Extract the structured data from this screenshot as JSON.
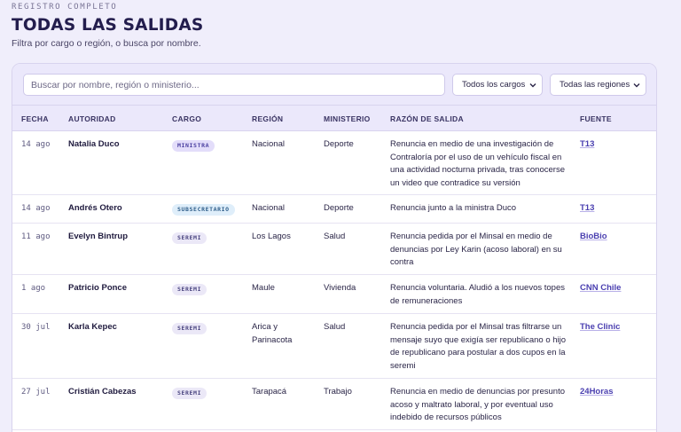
{
  "header": {
    "eyebrow": "REGISTRO COMPLETO",
    "title": "TODAS LAS SALIDAS",
    "subtitle": "Filtra por cargo o región, o busca por nombre."
  },
  "filters": {
    "search_placeholder": "Buscar por nombre, región o ministerio...",
    "cargo_value": "Todos los cargos",
    "region_value": "Todas las regiones"
  },
  "table": {
    "columns": {
      "fecha": "FECHA",
      "autoridad": "AUTORIDAD",
      "cargo": "CARGO",
      "region": "REGIÓN",
      "ministerio": "MINISTERIO",
      "razon": "RAZÓN DE SALIDA",
      "fuente": "FUENTE"
    },
    "rows": [
      {
        "fecha": "14 ago",
        "autoridad": "Natalia Duco",
        "cargo": "MINISTRA",
        "region": "Nacional",
        "ministerio": "Deporte",
        "razon": "Renuncia en medio de una investigación de Contraloría por el uso de un vehículo fiscal en una actividad nocturna privada, tras conocerse un video que contradice su versión",
        "fuente": "T13"
      },
      {
        "fecha": "14 ago",
        "autoridad": "Andrés Otero",
        "cargo": "SUBSECRETARIO",
        "region": "Nacional",
        "ministerio": "Deporte",
        "razon": "Renuncia junto a la ministra Duco",
        "fuente": "T13"
      },
      {
        "fecha": "11 ago",
        "autoridad": "Evelyn Bintrup",
        "cargo": "SEREMI",
        "region": "Los Lagos",
        "ministerio": "Salud",
        "razon": "Renuncia pedida por el Minsal en medio de denuncias por Ley Karin (acoso laboral) en su contra",
        "fuente": "BioBio"
      },
      {
        "fecha": "1 ago",
        "autoridad": "Patricio Ponce",
        "cargo": "SEREMI",
        "region": "Maule",
        "ministerio": "Vivienda",
        "razon": "Renuncia voluntaria. Aludió a los nuevos topes de remuneraciones",
        "fuente": "CNN Chile"
      },
      {
        "fecha": "30 jul",
        "autoridad": "Karla Kepec",
        "cargo": "SEREMI",
        "region": "Arica y Parinacota",
        "ministerio": "Salud",
        "razon": "Renuncia pedida por el Minsal tras filtrarse un mensaje suyo que exigía ser republicano o hijo de republicano para postular a dos cupos en la seremi",
        "fuente": "The Clinic"
      },
      {
        "fecha": "27 jul",
        "autoridad": "Cristián Cabezas",
        "cargo": "SEREMI",
        "region": "Tarapacá",
        "ministerio": "Trabajo",
        "razon": "Renuncia en medio de denuncias por presunto acoso y maltrato laboral, y por eventual uso indebido de recursos públicos",
        "fuente": "24Horas"
      }
    ]
  }
}
